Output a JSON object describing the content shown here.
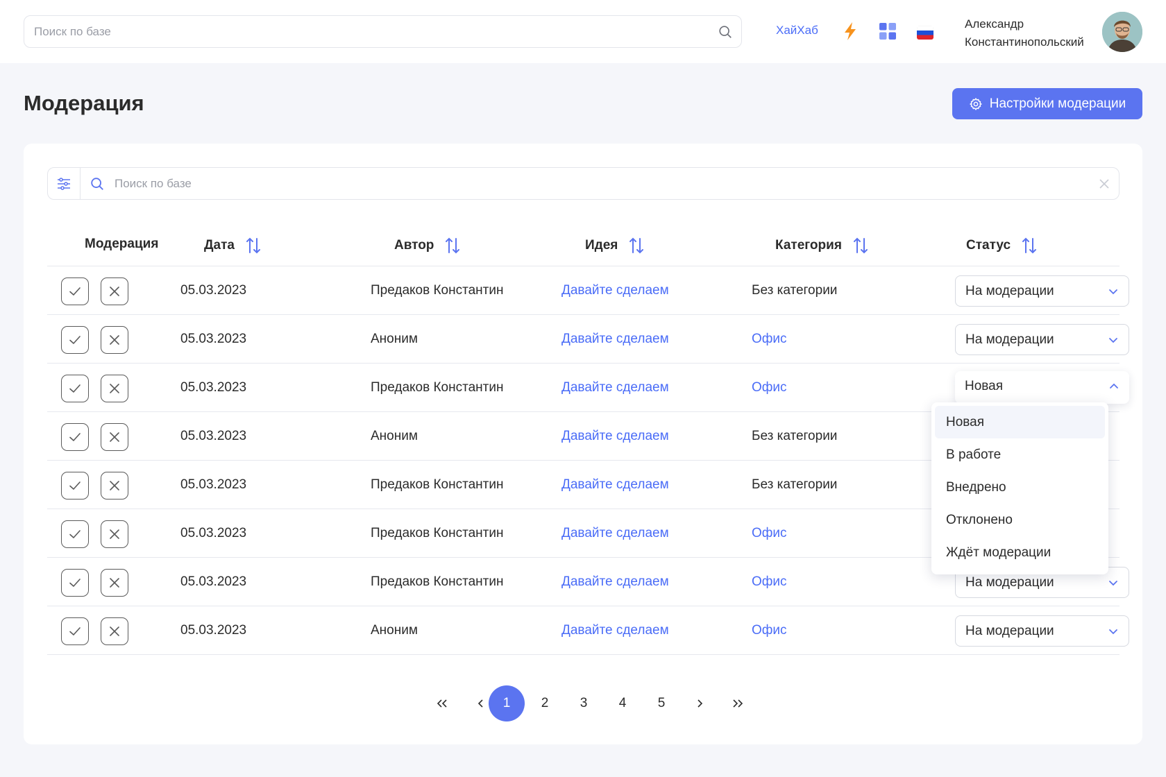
{
  "header": {
    "search_placeholder": "Поиск по базе",
    "hub_link": "ХайХаб",
    "user_name_first": "Александр",
    "user_name_last": "Константинопольский"
  },
  "page": {
    "title": "Модерация",
    "settings_button": "Настройки модерации"
  },
  "table_search": {
    "placeholder": "Поиск по базе"
  },
  "table": {
    "columns": [
      "Модерация",
      "Дата",
      "Автор",
      "Идея",
      "Категория",
      "Статус"
    ],
    "rows": [
      {
        "date": "05.03.2023",
        "author": "Предаков Константин",
        "idea": "Давайте сделаем",
        "category": "Без категории",
        "category_link": false,
        "status": "На модерации"
      },
      {
        "date": "05.03.2023",
        "author": "Аноним",
        "idea": "Давайте сделаем",
        "category": "Офис",
        "category_link": true,
        "status": "На модерации"
      },
      {
        "date": "05.03.2023",
        "author": "Предаков Константин",
        "idea": "Давайте сделаем",
        "category": "Офис",
        "category_link": true,
        "status": "Новая"
      },
      {
        "date": "05.03.2023",
        "author": "Аноним",
        "idea": "Давайте сделаем",
        "category": "Без категории",
        "category_link": false,
        "status": ""
      },
      {
        "date": "05.03.2023",
        "author": "Предаков Константин",
        "idea": "Давайте сделаем",
        "category": "Без категории",
        "category_link": false,
        "status": ""
      },
      {
        "date": "05.03.2023",
        "author": "Предаков Константин",
        "idea": "Давайте сделаем",
        "category": "Офис",
        "category_link": true,
        "status": ""
      },
      {
        "date": "05.03.2023",
        "author": "Предаков Константин",
        "idea": "Давайте сделаем",
        "category": "Офис",
        "category_link": true,
        "status": "На модерации"
      },
      {
        "date": "05.03.2023",
        "author": "Аноним",
        "idea": "Давайте сделаем",
        "category": "Офис",
        "category_link": true,
        "status": "На модерации"
      }
    ]
  },
  "status_dropdown": {
    "options": [
      "Новая",
      "В работе",
      "Внедрено",
      "Отклонено",
      "Ждёт модерации"
    ],
    "selected": "Новая"
  },
  "pagination": {
    "pages": [
      "1",
      "2",
      "3",
      "4",
      "5"
    ],
    "current": "1"
  },
  "colors": {
    "accent": "#5b74f0",
    "link": "#4a6cf7",
    "bolt": "#f7931e"
  }
}
